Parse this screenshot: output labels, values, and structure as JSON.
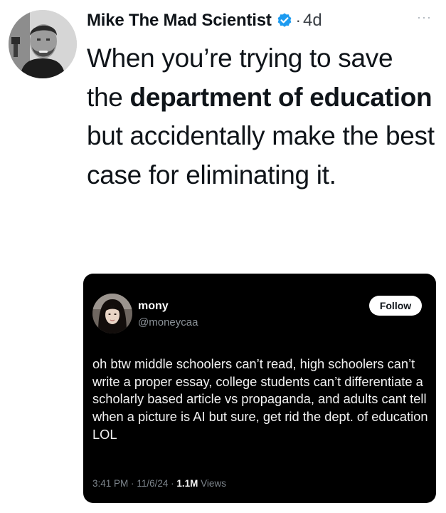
{
  "tweet": {
    "author_name": "Mike The Mad Scientist",
    "separator": "·",
    "time": "4d",
    "more": "···",
    "text": [
      {
        "content": "When you’re trying to save the ",
        "bold": false
      },
      {
        "content": "department of education",
        "bold": true
      },
      {
        "content": " but accidentally make the best case for eliminating it.",
        "bold": false
      }
    ]
  },
  "quote": {
    "display_name": "mony",
    "handle": "@moneycaa",
    "follow_label": "Follow",
    "body": "oh btw middle schoolers can’t read, high schoolers can’t write a proper essay, college students can’t differentiate a scholarly based article vs propaganda, and adults cant tell when a picture is AI but sure, get rid the dept. of education LOL",
    "time": "3:41 PM",
    "date": "11/6/24",
    "views_count": "1.1M",
    "views_label": "Views",
    "separator": "·"
  },
  "icons": {
    "verified": "verified-badge-icon",
    "more": "more-options-icon"
  },
  "colors": {
    "verified": "#1d9bf0",
    "quote_background": "#000000",
    "follow_button": "#ffffff"
  }
}
